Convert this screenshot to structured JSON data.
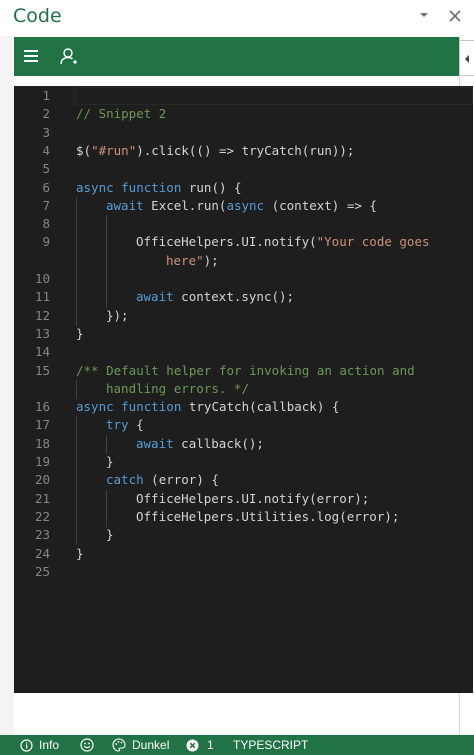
{
  "pane": {
    "title": "Code"
  },
  "icons": {
    "chevron": "chevron-down-icon",
    "close": "close-icon",
    "menu": "hamburger-menu-icon",
    "person": "person-icon",
    "collapse": "chevron-left-icon",
    "info": "info-icon",
    "smiley": "smiley-icon",
    "palette": "palette-icon",
    "error": "error-circle-icon"
  },
  "colors": {
    "accent": "#217346",
    "editor_bg": "#1e1e1e",
    "keyword": "#569cd6",
    "comment": "#6a9955",
    "string": "#ce9178",
    "text": "#d4d4d4",
    "line_number": "#858585"
  },
  "editor": {
    "lines": [
      {
        "n": "1",
        "indent": 0,
        "tokens": []
      },
      {
        "n": "2",
        "indent": 0,
        "tokens": [
          {
            "t": "cm",
            "v": "// Snippet 2"
          }
        ]
      },
      {
        "n": "3",
        "indent": 0,
        "tokens": []
      },
      {
        "n": "4",
        "indent": 0,
        "tokens": [
          {
            "t": "tx",
            "v": "$("
          },
          {
            "t": "str",
            "v": "\"#run\""
          },
          {
            "t": "tx",
            "v": ").click(() => tryCatch(run));"
          }
        ]
      },
      {
        "n": "5",
        "indent": 0,
        "tokens": []
      },
      {
        "n": "6",
        "indent": 0,
        "tokens": [
          {
            "t": "kw",
            "v": "async function"
          },
          {
            "t": "tx",
            "v": " run() {"
          }
        ]
      },
      {
        "n": "7",
        "indent": 1,
        "tokens": [
          {
            "t": "kw",
            "v": "await"
          },
          {
            "t": "tx",
            "v": " Excel.run("
          },
          {
            "t": "kw",
            "v": "async"
          },
          {
            "t": "tx",
            "v": " (context) => {"
          }
        ]
      },
      {
        "n": "8",
        "indent": 2,
        "tokens": []
      },
      {
        "n": "9",
        "indent": 2,
        "tokens": [
          {
            "t": "tx",
            "v": "OfficeHelpers.UI.notify("
          },
          {
            "t": "str",
            "v": "\"Your code goes"
          }
        ]
      },
      {
        "n": "",
        "indent": 3,
        "tokens": [
          {
            "t": "str",
            "v": "here\""
          },
          {
            "t": "tx",
            "v": ");"
          }
        ]
      },
      {
        "n": "10",
        "indent": 2,
        "tokens": []
      },
      {
        "n": "11",
        "indent": 2,
        "tokens": [
          {
            "t": "kw",
            "v": "await"
          },
          {
            "t": "tx",
            "v": " context.sync();"
          }
        ]
      },
      {
        "n": "12",
        "indent": 1,
        "tokens": [
          {
            "t": "tx",
            "v": "});"
          }
        ]
      },
      {
        "n": "13",
        "indent": 0,
        "tokens": [
          {
            "t": "tx",
            "v": "}"
          }
        ]
      },
      {
        "n": "14",
        "indent": 0,
        "tokens": []
      },
      {
        "n": "15",
        "indent": 0,
        "tokens": [
          {
            "t": "cm",
            "v": "/** Default helper for invoking an action and"
          }
        ]
      },
      {
        "n": "",
        "indent": 1,
        "tokens": [
          {
            "t": "cm",
            "v": "handling errors. */"
          }
        ]
      },
      {
        "n": "16",
        "indent": 0,
        "tokens": [
          {
            "t": "kw",
            "v": "async function"
          },
          {
            "t": "tx",
            "v": " tryCatch(callback) {"
          }
        ]
      },
      {
        "n": "17",
        "indent": 1,
        "tokens": [
          {
            "t": "kw",
            "v": "try"
          },
          {
            "t": "tx",
            "v": " {"
          }
        ]
      },
      {
        "n": "18",
        "indent": 2,
        "tokens": [
          {
            "t": "kw",
            "v": "await"
          },
          {
            "t": "tx",
            "v": " callback();"
          }
        ]
      },
      {
        "n": "19",
        "indent": 1,
        "tokens": [
          {
            "t": "tx",
            "v": "}"
          }
        ]
      },
      {
        "n": "20",
        "indent": 1,
        "tokens": [
          {
            "t": "kw",
            "v": "catch"
          },
          {
            "t": "tx",
            "v": " (error) {"
          }
        ]
      },
      {
        "n": "21",
        "indent": 2,
        "tokens": [
          {
            "t": "tx",
            "v": "OfficeHelpers.UI.notify(error);"
          }
        ]
      },
      {
        "n": "22",
        "indent": 2,
        "tokens": [
          {
            "t": "tx",
            "v": "OfficeHelpers.Utilities.log(error);"
          }
        ]
      },
      {
        "n": "23",
        "indent": 1,
        "tokens": [
          {
            "t": "tx",
            "v": "}"
          }
        ]
      },
      {
        "n": "24",
        "indent": 0,
        "tokens": [
          {
            "t": "tx",
            "v": "}"
          }
        ]
      },
      {
        "n": "25",
        "indent": 0,
        "tokens": []
      }
    ]
  },
  "statusbar": {
    "info_label": "Info",
    "theme_label": "Dunkel",
    "error_count": "1",
    "language_label": "TYPESCRIPT"
  }
}
